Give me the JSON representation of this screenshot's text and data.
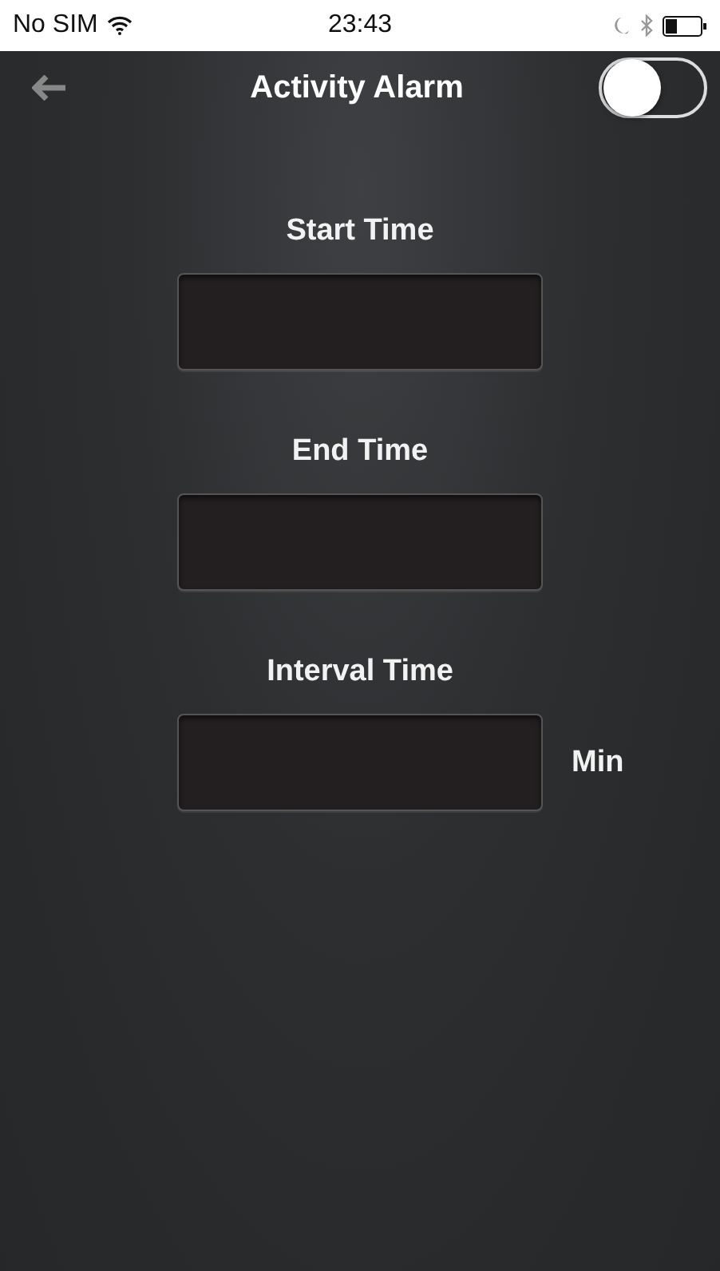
{
  "status_bar": {
    "carrier": "No SIM",
    "time": "23:43"
  },
  "nav": {
    "title": "Activity Alarm",
    "toggle": {
      "on": false
    }
  },
  "fields": [
    {
      "label": "Start Time"
    },
    {
      "label": "End Time"
    },
    {
      "label": "Interval Time",
      "unit": "Min"
    }
  ]
}
